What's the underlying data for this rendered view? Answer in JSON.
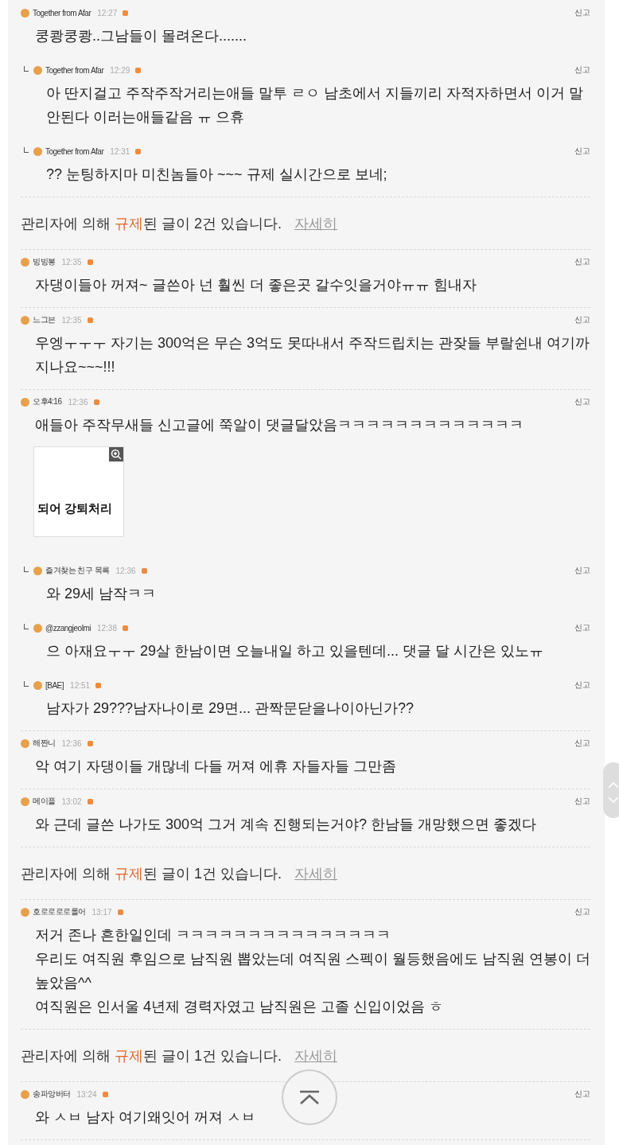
{
  "items": [
    {
      "kind": "comment",
      "author": "Together from Afar",
      "time": "12:27",
      "report": "신고",
      "lines": [
        "쿵쾅쿵쾅..그남들이 몰려온다......."
      ],
      "children": [
        {
          "kind": "comment",
          "author": "Together from Afar",
          "time": "12:29",
          "report": "신고",
          "lines": [
            "아 딴지걸고 주작주작거리는애들 말투 ㄹㅇ 남초에서 지들끼리 자적자하면서 이거 말안된다 이러는애들같음 ㅠ 으휴"
          ]
        },
        {
          "kind": "comment",
          "author": "Together from Afar",
          "time": "12:31",
          "report": "신고",
          "lines": [
            "?? 눈팅하지마 미친놈들아 ~~~ 규제 실시간으로 보네;"
          ]
        }
      ]
    },
    {
      "kind": "notice",
      "before": "관리자에 의해 ",
      "highlight": "규제",
      "after": "된 글이  2건 있습니다.",
      "link": "자세히"
    },
    {
      "kind": "comment",
      "author": "빙빙봉",
      "time": "12:35",
      "report": "신고",
      "lines": [
        "자댕이들아 꺼져~ 글쓴아 넌 훨씬 더 좋은곳 갈수잇을거야ㅠㅠ 힘내자"
      ]
    },
    {
      "kind": "comment",
      "author": "느그븐",
      "time": "12:35",
      "report": "신고",
      "lines": [
        "우엥ㅜㅜㅜ 자기는 300억은 무슨 3억도 못따내서 주작드립치는 관잦들 부랄쉰내 여기까지나요~~~!!!"
      ]
    },
    {
      "kind": "comment",
      "author": "오후4:16",
      "time": "12:36",
      "report": "신고",
      "lines": [
        "애들아 주작무새들 신고글에 쭉알이 댓글달았음ㅋㅋㅋㅋㅋㅋㅋㅋㅋㅋㅋㅋㅋ"
      ],
      "image_text": "되어 강퇴처리",
      "children": [
        {
          "kind": "comment",
          "author": "즐겨찾는 친구 목록",
          "time": "12:36",
          "report": "신고",
          "lines": [
            "와 29세 남작ㅋㅋ"
          ]
        },
        {
          "kind": "comment",
          "author": "@zzangjeolmi",
          "time": "12:38",
          "report": "신고",
          "lines": [
            "으 아재요ㅜㅜ 29살 한남이면 오늘내일 하고 있을텐데... 댓글 달 시간은 있노ㅠ"
          ]
        },
        {
          "kind": "comment",
          "author": "[BAE]",
          "time": "12:51",
          "report": "신고",
          "lines": [
            "남자가 29???남자나이로 29면... 관짝문닫을나이아닌가??"
          ]
        }
      ]
    },
    {
      "kind": "comment",
      "author": "해짠니",
      "time": "12:36",
      "report": "신고",
      "lines": [
        "악 여기 자댕이들 개많네 다들 꺼져 에휴 자들자들 그만좀"
      ]
    },
    {
      "kind": "comment",
      "author": "메이플",
      "time": "13:02",
      "report": "신고",
      "lines": [
        "와 근데 글쓴 나가도 300억 그거 계속 진행되는거야? 한남들 개망했으면 좋겠다"
      ]
    },
    {
      "kind": "notice",
      "before": "관리자에 의해 ",
      "highlight": "규제",
      "after": "된 글이  1건 있습니다.",
      "link": "자세히"
    },
    {
      "kind": "comment",
      "author": "호로로로로롤어",
      "time": "13:17",
      "report": "신고",
      "lines": [
        "저거 존나 흔한일인데 ㅋㅋㅋㅋㅋㅋㅋㅋㅋㅋㅋㅋㅋㅋㅋ",
        "우리도 여직원 후임으로 남직원 뽑았는데 여직원 스펙이 월등했음에도 남직원 연봉이 더 높았음^^",
        "여직원은 인서울 4년제 경력자였고 남직원은 고졸 신입이었음 ㅎ"
      ]
    },
    {
      "kind": "notice",
      "before": "관리자에 의해 ",
      "highlight": "규제",
      "after": "된 글이  1건 있습니다.",
      "link": "자세히"
    },
    {
      "kind": "comment",
      "author": "송파앙버터",
      "time": "13:24",
      "report": "신고",
      "lines": [
        "와 ㅅㅂ 남자 여기왜잇어 꺼져 ㅅㅂ"
      ]
    }
  ]
}
